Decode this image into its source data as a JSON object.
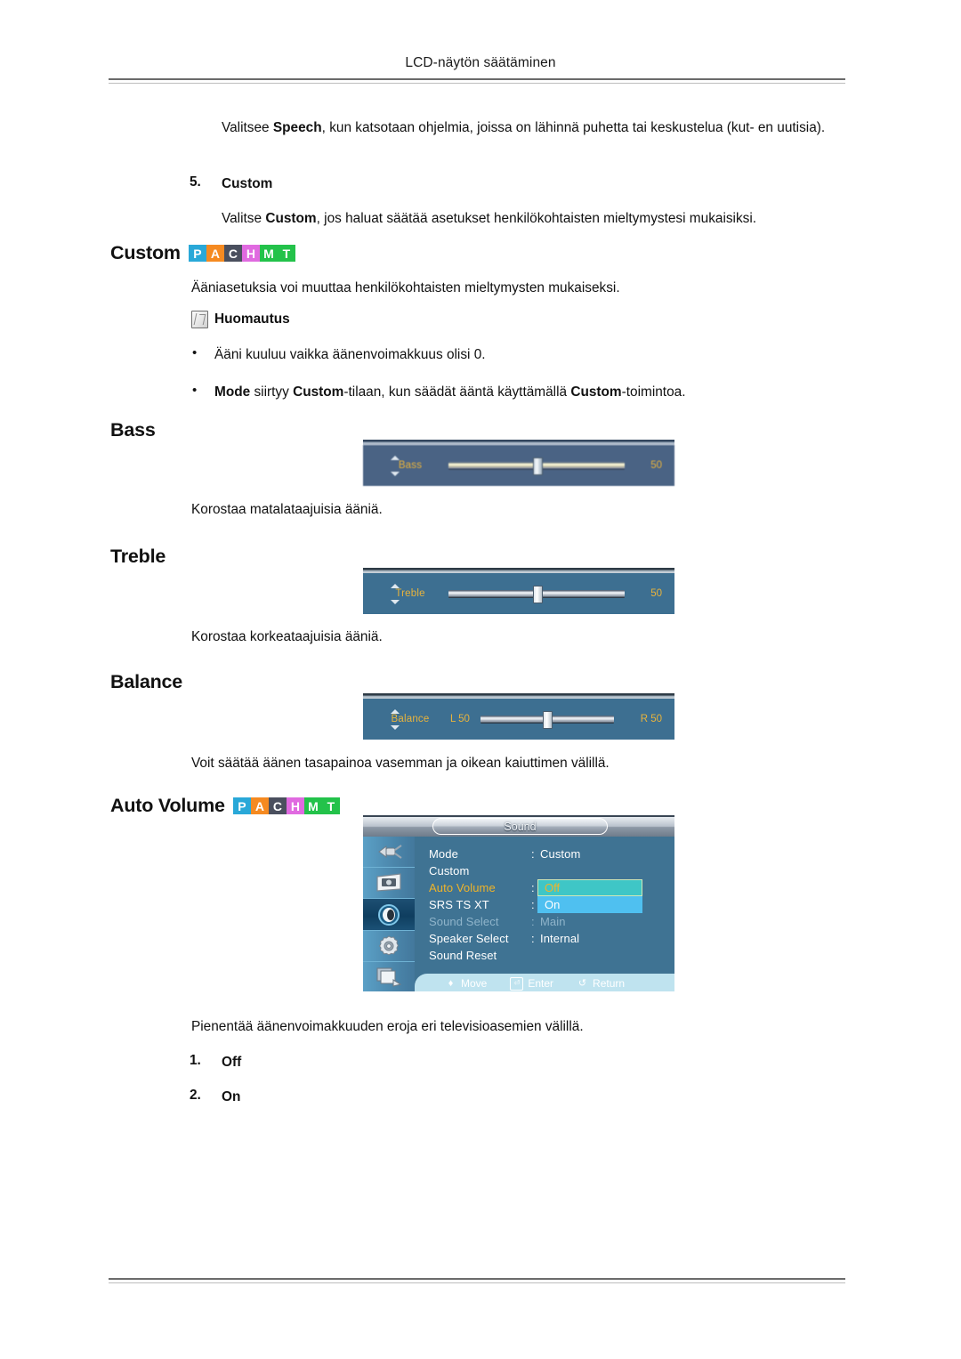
{
  "header": {
    "running_title": "LCD-näytön säätäminen"
  },
  "intro": {
    "paragraph_line1_a": "Valitsee ",
    "paragraph_line1_b": "Speech",
    "paragraph_line1_c": ", kun katsotaan ohjelmia, joissa on lähinnä puhetta tai keskustelua (kut-",
    "paragraph_line2": "en uutisia)."
  },
  "list_item_5": {
    "number": "5.",
    "label": "Custom",
    "description_a": "Valitse ",
    "description_b": "Custom",
    "description_c": ", jos haluat säätää asetukset henkilökohtaisten mieltymystesi mukaisiksi."
  },
  "badge": {
    "letters": [
      "P",
      "A",
      "C",
      "H",
      "M",
      "T"
    ],
    "colors": [
      "#29a8d8",
      "#f58a21",
      "#4a4f5e",
      "#e06ae0",
      "#23c24a",
      "#23c24a"
    ]
  },
  "sections": {
    "custom": {
      "heading": "Custom",
      "paragraph": "Ääniasetuksia voi muuttaa henkilökohtaisten mieltymysten mukaiseksi.",
      "note_label": "Huomautus",
      "bullets": [
        {
          "bullet": "•",
          "text": "Ääni kuuluu vaikka äänenvoimakkuus olisi 0."
        },
        {
          "bullet": "•",
          "prefix_bold": "Mode",
          "mid1": " siirtyy ",
          "bold1": "Custom",
          "mid2": "-tilaan, kun säädät ääntä käyttämällä ",
          "bold2": "Custom",
          "mid3": "-toimintoa."
        }
      ]
    },
    "bass": {
      "heading": "Bass",
      "description": "Korostaa matalataajuisia ääniä.",
      "osd": {
        "label": "Bass",
        "value": "50",
        "knob_percent": 50
      }
    },
    "treble": {
      "heading": "Treble",
      "description": "Korostaa korkeataajuisia ääniä.",
      "osd": {
        "label": "Treble",
        "value": "50",
        "knob_percent": 50
      }
    },
    "balance": {
      "heading": "Balance",
      "description": "Voit säätää äänen tasapainoa vasemman ja oikean kaiuttimen välillä.",
      "osd": {
        "label": "Balance",
        "left_label": "L  50",
        "right_label": "R  50",
        "knob_percent": 50
      }
    },
    "auto_volume": {
      "heading": "Auto Volume",
      "description": "Pienentää äänenvoimakkuuden eroja eri televisioasemien välillä.",
      "options": [
        {
          "number": "1.",
          "label": "Off"
        },
        {
          "number": "2.",
          "label": "On"
        }
      ]
    }
  },
  "sound_osd": {
    "title": "Sound",
    "sidebar_icons": [
      {
        "name": "input-plug-icon",
        "active": false
      },
      {
        "name": "picture-screen-icon",
        "active": false
      },
      {
        "name": "sound-speaker-icon",
        "active": true
      },
      {
        "name": "setup-gear-icon",
        "active": false
      },
      {
        "name": "multi-control-icon",
        "active": false
      }
    ],
    "rows": [
      {
        "label": "Mode",
        "colon": ":",
        "value": "Custom",
        "state": "normal"
      },
      {
        "label": "Custom",
        "colon": "",
        "value": "",
        "state": "normal"
      },
      {
        "label": "Auto Volume",
        "colon": ":",
        "value": "",
        "state": "highlight"
      },
      {
        "label": "SRS TS XT",
        "colon": ":",
        "value": "",
        "state": "normal"
      },
      {
        "label": "Sound Select",
        "colon": ":",
        "value": "Main",
        "state": "dim"
      },
      {
        "label": "Speaker Select",
        "colon": ":",
        "value": "Internal",
        "state": "normal"
      },
      {
        "label": "Sound Reset",
        "colon": "",
        "value": "",
        "state": "normal"
      }
    ],
    "dropdown": {
      "selected": "Off",
      "other": "On"
    },
    "footer": [
      {
        "glyph": "move-arrows-icon",
        "label": "Move"
      },
      {
        "glyph": "enter-icon",
        "label": "Enter"
      },
      {
        "glyph": "return-icon",
        "label": "Return"
      }
    ],
    "colors": {
      "menu_bg": "#3f7393",
      "sidebar": "#4b86ab",
      "highlight_text": "#f0b429",
      "dropdown_selected_bg": "#3fc6c6",
      "dropdown_other_bg": "#4fc0f0",
      "footer_bg": "#bfe3ef"
    }
  }
}
